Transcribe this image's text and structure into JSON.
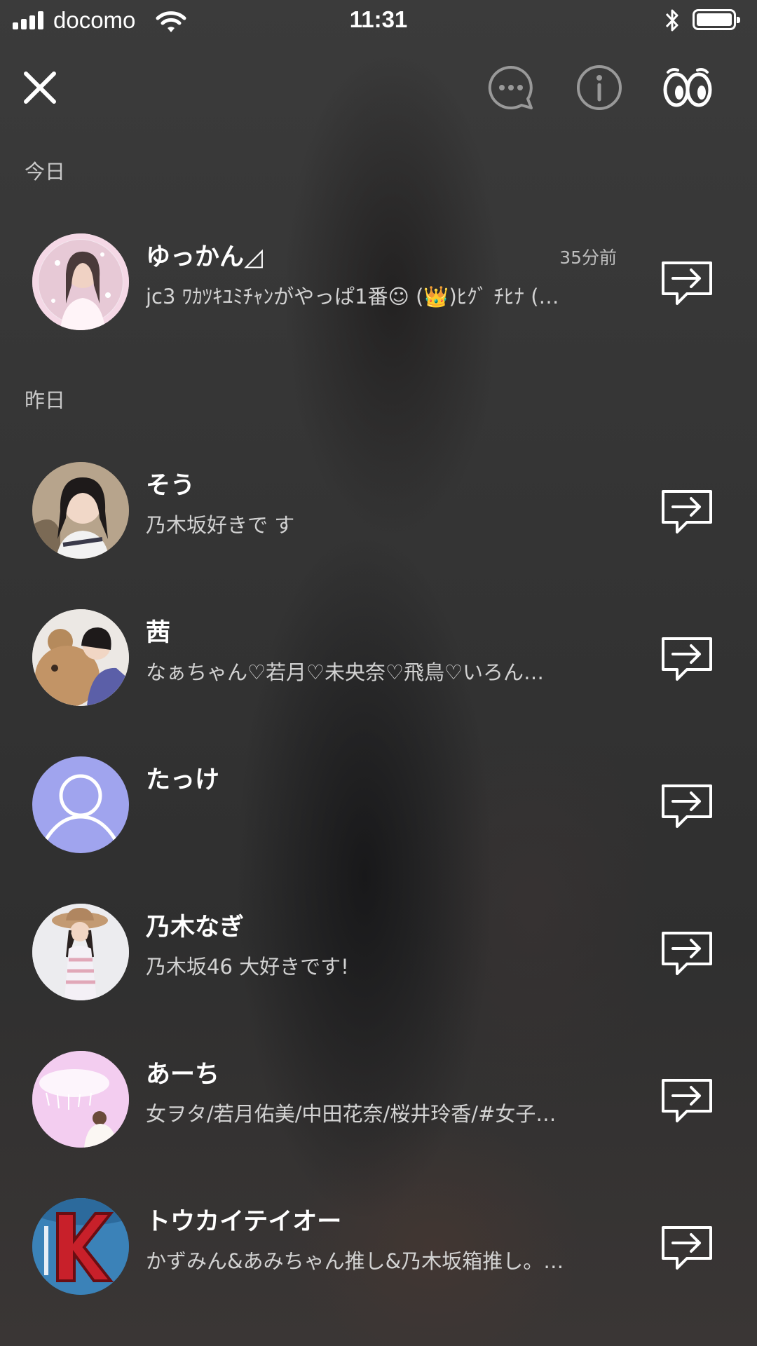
{
  "status_bar": {
    "carrier": "docomo",
    "time": "11:31",
    "battery_level": 1.0
  },
  "toolbar": {
    "close_icon": "close-icon",
    "chat_icon": "chat-bubble-icon",
    "info_icon": "info-icon",
    "watch_icon": "eyes-icon"
  },
  "sections": [
    {
      "header": "今日",
      "rows": [
        {
          "name": "ゆっかん◿",
          "preview": "jc3 ﾜｶﾂｷﾕﾐﾁｬﾝがやっぱ1番☺ (👑)ﾋｸﾞ ﾁﾋﾅ (…",
          "time": "35分前",
          "avatar": "photo-pink"
        }
      ]
    },
    {
      "header": "昨日",
      "rows": [
        {
          "name": "そう",
          "preview": "乃木坂好きで す",
          "avatar": "photo-girl"
        },
        {
          "name": "茜",
          "preview": "なぁちゃん♡若月♡未央奈♡飛鳥♡いろん…",
          "avatar": "photo-bear"
        },
        {
          "name": "たっけ",
          "preview": "",
          "avatar": "default-user"
        },
        {
          "name": "乃木なぎ",
          "preview": "乃木坂46 大好きです!",
          "avatar": "photo-hat"
        },
        {
          "name": "あーち",
          "preview": "女ヲタ/若月佑美/中田花奈/桜井玲香/#女子…",
          "avatar": "photo-pastel"
        },
        {
          "name": "トウカイテイオー",
          "preview": "かずみん&あみちゃん推し&乃木坂箱推し。…",
          "avatar": "logo-k"
        }
      ]
    }
  ],
  "colors": {
    "default_avatar_bg": "#a0a4ee",
    "row_text": "#ffffff",
    "preview_text": "#d2d2d2"
  }
}
